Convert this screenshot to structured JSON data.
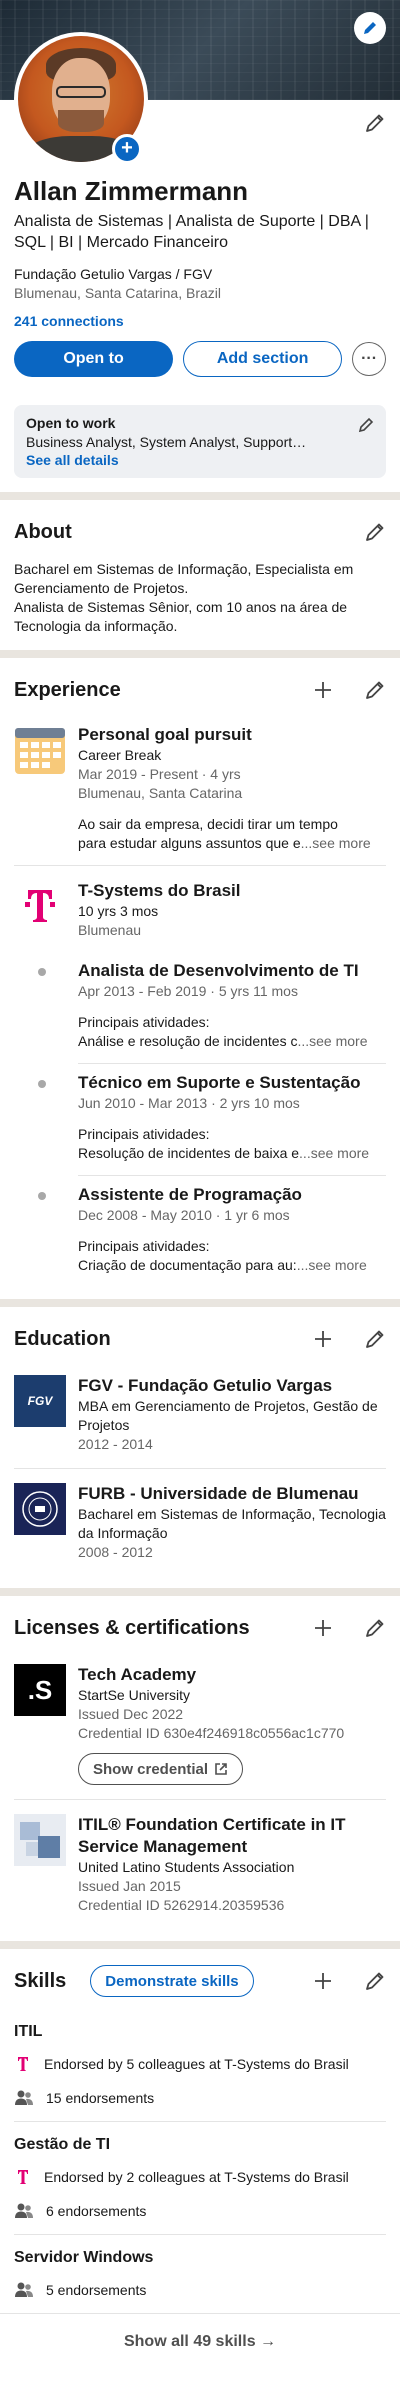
{
  "profile": {
    "name": "Allan Zimmermann",
    "headline": "Analista de Sistemas | Analista de Suporte | DBA | SQL | BI | Mercado Financeiro",
    "education": "Fundação Getulio Vargas  / FGV",
    "location": "Blumenau, Santa Catarina, Brazil",
    "connections": "241 connections",
    "open_to_label": "Open to",
    "add_section_label": "Add section",
    "more_label": "···"
  },
  "open_to_work": {
    "title": "Open to work",
    "text": "Business Analyst, System Analyst, Support…",
    "link": "See all details"
  },
  "about": {
    "title": "About",
    "text1": "Bacharel em Sistemas de Informação, Especialista em Gerenciamento de Projetos.",
    "text2": "Analista de Sistemas Sênior, com 10 anos na área de Tecnologia da informação."
  },
  "experience": {
    "title": "Experience",
    "items": [
      {
        "title": "Personal goal pursuit",
        "subtitle": "Career Break",
        "dates": "Mar 2019 - Present · 4 yrs",
        "location": "Blumenau, Santa Catarina",
        "desc1": "Ao sair da empresa, decidi tirar um tempo",
        "desc2": "para estudar alguns assuntos que e",
        "see_more": "...see more"
      },
      {
        "title": "T-Systems do Brasil",
        "subtitle": "10 yrs 3 mos",
        "location": "Blumenau",
        "roles": [
          {
            "title": "Analista de Desenvolvimento de TI",
            "dates": "Apr 2013 - Feb 2019 · 5 yrs 11 mos",
            "desc1": "Principais atividades:",
            "desc2": "Análise e resolução de incidentes c",
            "see_more": "...see more"
          },
          {
            "title": "Técnico em Suporte e Sustentação",
            "dates": "Jun 2010 - Mar 2013 · 2 yrs 10 mos",
            "desc1": "Principais atividades:",
            "desc2": "Resolução de incidentes de baixa e",
            "see_more": "...see more"
          },
          {
            "title": "Assistente de Programação",
            "dates": "Dec 2008 - May 2010 · 1 yr 6 mos",
            "desc1": "Principais atividades:",
            "desc2": "Criação de documentação para au:",
            "see_more": "...see more"
          }
        ]
      }
    ]
  },
  "education": {
    "title": "Education",
    "items": [
      {
        "logo": "FGV",
        "title": "FGV - Fundação Getulio Vargas",
        "degree": "MBA em Gerenciamento de Projetos, Gestão de Projetos",
        "dates": "2012 - 2014"
      },
      {
        "title": "FURB - Universidade de Blumenau",
        "degree": "Bacharel em Sistemas de Informação, Tecnologia da Informação",
        "dates": "2008 - 2012"
      }
    ]
  },
  "licenses": {
    "title": "Licenses & certifications",
    "items": [
      {
        "logo": ".S",
        "title": "Tech Academy",
        "issuer": "StartSe University",
        "issued": "Issued Dec 2022",
        "credential": "Credential ID 630e4f246918c0556ac1c770",
        "button": "Show credential"
      },
      {
        "title": "ITIL® Foundation Certificate in IT Service Management",
        "issuer": "United Latino Students Association",
        "issued": "Issued Jan 2015",
        "credential": "Credential ID 5262914.20359536"
      }
    ]
  },
  "skills": {
    "title": "Skills",
    "demo_button": "Demonstrate skills",
    "items": [
      {
        "name": "ITIL",
        "endorsed_by": "Endorsed by 5 colleagues at T-Systems do Brasil",
        "endorsements": "15 endorsements"
      },
      {
        "name": "Gestão de TI",
        "endorsed_by": "Endorsed by 2 colleagues at T-Systems do Brasil",
        "endorsements": "6 endorsements"
      },
      {
        "name": "Servidor Windows",
        "endorsements": "5 endorsements"
      }
    ],
    "show_all": "Show all 49 skills →"
  },
  "colors": {
    "accent": "#0a66c2",
    "telekom": "#e20074",
    "divider": "#e9e5df"
  }
}
